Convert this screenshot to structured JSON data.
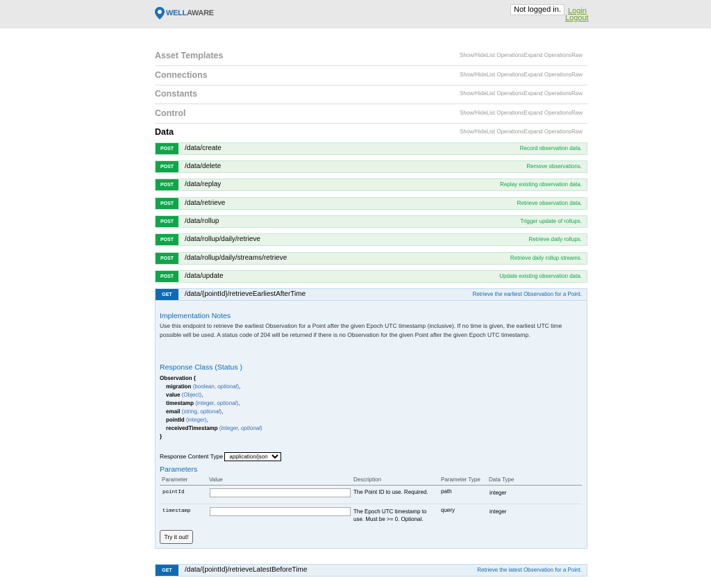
{
  "header": {
    "logo_part1": "WELL",
    "logo_part2": "AWARE",
    "login_status": "Not logged in.",
    "login_label": "Login",
    "logout_label": "Logout",
    "brand_color": "#1f6fb4",
    "link_color": "#6a9e1f"
  },
  "ops_labels": {
    "show_hide": "Show/Hide",
    "list": "List Operations",
    "expand": "Expand Operations",
    "raw": "Raw"
  },
  "resources": [
    {
      "name": "Asset Templates"
    },
    {
      "name": "Connections"
    },
    {
      "name": "Constants"
    },
    {
      "name": "Control"
    },
    {
      "name": "Data"
    }
  ],
  "operations": [
    {
      "method": "POST",
      "path": "/data/create",
      "summary": "Record observation data."
    },
    {
      "method": "POST",
      "path": "/data/delete",
      "summary": "Remove observations."
    },
    {
      "method": "POST",
      "path": "/data/replay",
      "summary": "Replay existing observation data."
    },
    {
      "method": "POST",
      "path": "/data/retrieve",
      "summary": "Retrieve observation data."
    },
    {
      "method": "POST",
      "path": "/data/rollup",
      "summary": "Trigger update of rollups."
    },
    {
      "method": "POST",
      "path": "/data/rollup/daily/retrieve",
      "summary": "Retrieve daily rollups."
    },
    {
      "method": "POST",
      "path": "/data/rollup/daily/streams/retrieve",
      "summary": "Retrieve daily rollup streams."
    },
    {
      "method": "POST",
      "path": "/data/update",
      "summary": "Update existing observation data."
    },
    {
      "method": "GET",
      "path": "/data/{pointId}/retrieveEarliestAfterTime",
      "summary": "Retrieve the earliest Observation for a Point."
    },
    {
      "method": "GET",
      "path": "/data/{pointId}/retrieveLatestBeforeTime",
      "summary": "Retrieve the latest Observation for a Point."
    }
  ],
  "details": {
    "impl_title": "Implementation Notes",
    "impl_text": "Use this endpoint to retrieve the earliest Observation for a Point after the given Epoch UTC timestamp (inclusive). If no time is given, the earliest UTC time possible will be used. A status code of 204 will be returned if there is no Observation for the given Point after the given Epoch UTC timestamp.",
    "response_class_title": "Response Class (Status )",
    "model_name": "Observation {",
    "model_close": "}",
    "model_props": [
      {
        "name": "migration",
        "type": "boolean",
        "optional": "optional"
      },
      {
        "name": "value",
        "type": "Object",
        "optional": ""
      },
      {
        "name": "timestamp",
        "type": "integer",
        "optional": "optional"
      },
      {
        "name": "email",
        "type": "string",
        "optional": "optional"
      },
      {
        "name": "pointId",
        "type": "integer",
        "optional": ""
      },
      {
        "name": "receivedTimestamp",
        "type": "integer",
        "optional": "optional"
      }
    ],
    "content_type_label": "Response Content Type",
    "content_type_value": "application/json",
    "params_title": "Parameters",
    "param_headers": {
      "parameter": "Parameter",
      "value": "Value",
      "description": "Description",
      "param_type": "Parameter Type",
      "data_type": "Data Type"
    },
    "params": [
      {
        "name": "pointId",
        "description": "The Point ID to use. Required.",
        "param_type": "path",
        "data_type": "integer"
      },
      {
        "name": "timestamp",
        "description": "The Epoch UTC timestamp to use. Must be >= 0. Optional.",
        "param_type": "query",
        "data_type": "integer"
      }
    ],
    "try_label": "Try it out!"
  }
}
